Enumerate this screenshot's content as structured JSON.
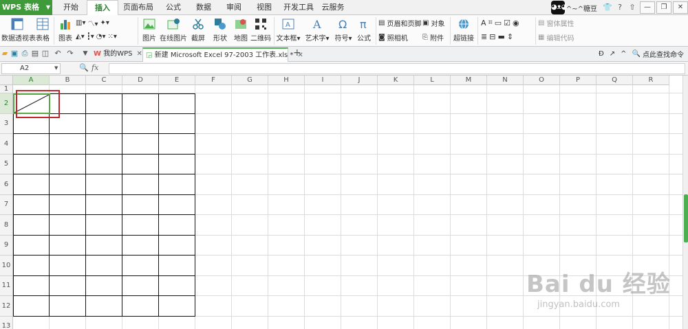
{
  "app": {
    "name": "WPS 表格"
  },
  "menus": [
    "开始",
    "插入",
    "页面布局",
    "公式",
    "数据",
    "审阅",
    "视图",
    "开发工具",
    "云服务"
  ],
  "active_menu": "插入",
  "user": {
    "name": "^~^糖豆"
  },
  "ribbon": {
    "buttons": [
      "数据透视表",
      "表格",
      "图表",
      "图片",
      "在线图片",
      "截屏",
      "形状",
      "地图",
      "二维码",
      "文本框",
      "艺术字",
      "符号",
      "公式",
      "超链接"
    ],
    "small_buttons": [
      "页眉和页脚",
      "对象",
      "照相机",
      "附件",
      "窗体属性",
      "编辑代码"
    ]
  },
  "tabs": [
    {
      "label": "我的WPS"
    },
    {
      "label": "新建 Microsoft Excel 97-2003 工作表.xls *"
    }
  ],
  "find_command": "点此查找命令",
  "formula_bar": {
    "name_box": "A2",
    "fx_label": "fx",
    "value": ""
  },
  "sheet": {
    "columns": [
      "A",
      "B",
      "C",
      "D",
      "E",
      "F",
      "G",
      "H",
      "I",
      "J",
      "K",
      "L",
      "M",
      "N",
      "O",
      "P",
      "Q",
      "R"
    ],
    "rows": [
      "1",
      "2",
      "3",
      "4",
      "5",
      "6",
      "7",
      "8",
      "9",
      "10",
      "11",
      "12",
      "13"
    ],
    "selected_cell": "A2",
    "bordered_range": "A2:E12",
    "diagonal_cell": "A2"
  },
  "colors": {
    "accent": "#3f9a3a",
    "highlight": "#c0272d",
    "selection": "#5aa845"
  },
  "watermark": {
    "brand": "Bai du 经验",
    "url": "jingyan.baidu.com"
  }
}
